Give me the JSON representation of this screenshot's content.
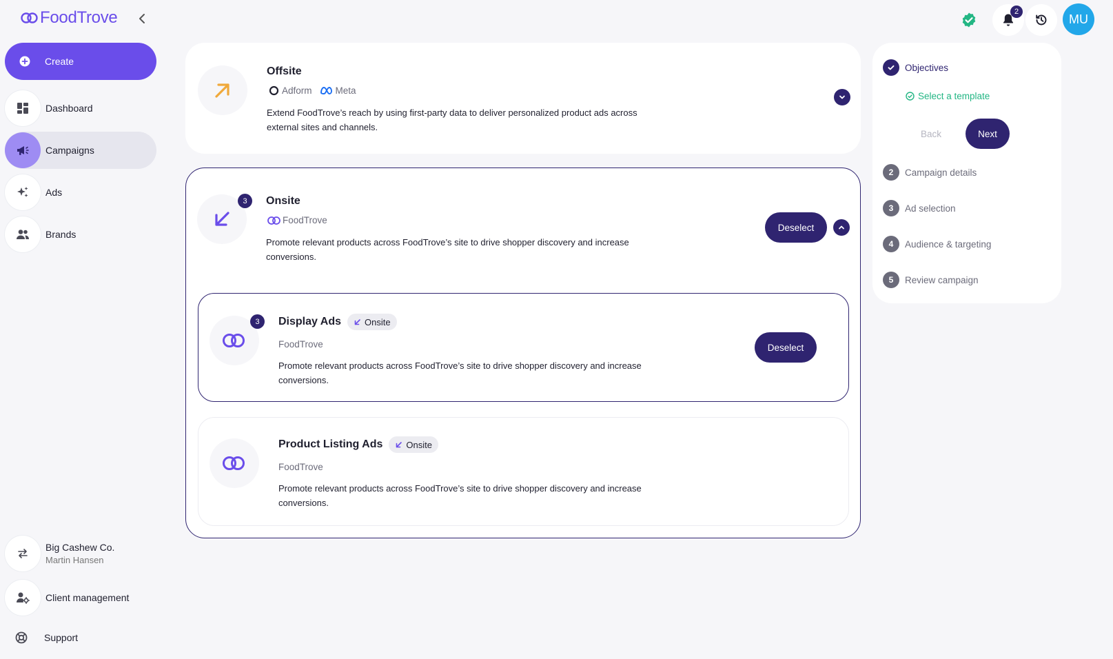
{
  "brand": {
    "name": "FoodTrove",
    "accent": "#6a4dea",
    "primary": "#2f2470"
  },
  "sidebar": {
    "collapse_icon": "chevron-left-icon",
    "create_label": "Create",
    "items": [
      {
        "label": "Dashboard",
        "icon": "dashboard-icon"
      },
      {
        "label": "Campaigns",
        "icon": "megaphone-icon"
      },
      {
        "label": "Ads",
        "icon": "sparkle-icon"
      },
      {
        "label": "Brands",
        "icon": "people-icon"
      }
    ],
    "account": {
      "company": "Big Cashew Co.",
      "user": "Martin Hansen"
    },
    "client_management": "Client management",
    "support": "Support"
  },
  "topbar": {
    "notifications_count": "2",
    "avatar_initials": "MU"
  },
  "objectives": {
    "offsite": {
      "title": "Offsite",
      "providers": [
        "Adform",
        "Meta"
      ],
      "description": "Extend FoodTrove’s reach by using first-party data to deliver personalized product ads across external sites and channels."
    },
    "onsite": {
      "title": "Onsite",
      "count": "3",
      "provider": "FoodTrove",
      "description": "Promote relevant products across FoodTrove’s site to drive shopper discovery and increase conversions.",
      "deselect_label": "Deselect",
      "ad_types": [
        {
          "title": "Display Ads",
          "tag": "Onsite",
          "count": "3",
          "provider": "FoodTrove",
          "description": "Promote relevant products across FoodTrove’s site to drive shopper discovery and increase conversions.",
          "deselect_label": "Deselect"
        },
        {
          "title": "Product Listing Ads",
          "tag": "Onsite",
          "provider": "FoodTrove",
          "description": "Promote relevant products across FoodTrove’s site to drive shopper discovery and increase conversions."
        }
      ]
    }
  },
  "steps": {
    "items": [
      {
        "num": "",
        "label": "Objectives",
        "state": "done"
      },
      {
        "num": "2",
        "label": "Campaign details",
        "state": "todo"
      },
      {
        "num": "3",
        "label": "Ad selection",
        "state": "todo"
      },
      {
        "num": "4",
        "label": "Audience & targeting",
        "state": "todo"
      },
      {
        "num": "5",
        "label": "Review campaign",
        "state": "todo"
      }
    ],
    "substep": "Select a template",
    "back_label": "Back",
    "next_label": "Next"
  }
}
